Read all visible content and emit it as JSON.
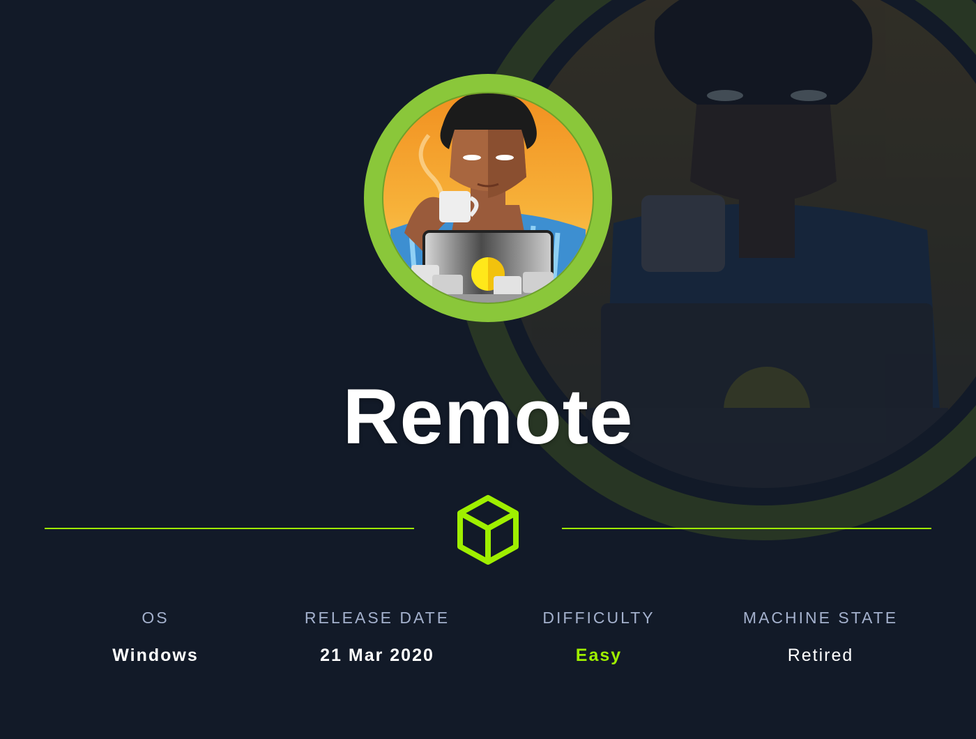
{
  "machine": {
    "name": "Remote"
  },
  "stats": [
    {
      "label": "OS",
      "value": "Windows"
    },
    {
      "label": "RELEASE DATE",
      "value": "21 Mar 2020"
    },
    {
      "label": "DIFFICULTY",
      "value": "Easy"
    },
    {
      "label": "MACHINE STATE",
      "value": "Retired"
    }
  ],
  "colors": {
    "background": "#121a28",
    "accent": "#9fef00",
    "ring": "#8ac73a",
    "label": "#a4b1cd",
    "value": "#ffffff"
  },
  "icons": {
    "logo": "hack-the-box-cube-icon"
  }
}
